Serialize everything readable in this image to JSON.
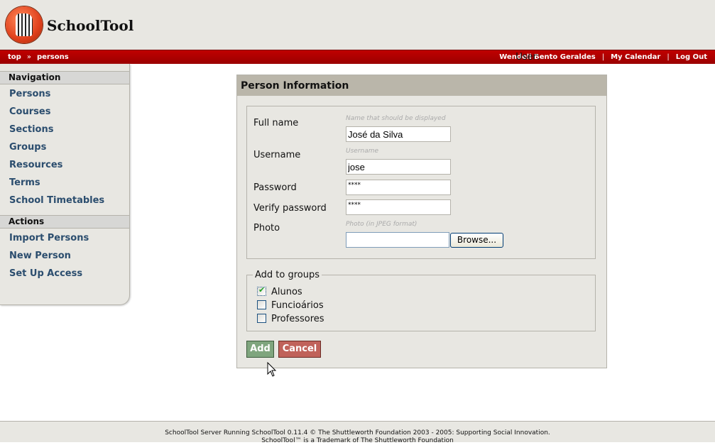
{
  "header": {
    "title": "SchoolTool"
  },
  "breadcrumb": [
    "top",
    "persons"
  ],
  "breadcrumb_sep": "»",
  "userbar": {
    "label": "User:",
    "user": "Wendell Bento Geraldes",
    "calendar": "My Calendar",
    "logout": "Log Out",
    "sep": "|"
  },
  "sidebar": {
    "navigation_title": "Navigation",
    "navigation": [
      "Persons",
      "Courses",
      "Sections",
      "Groups",
      "Resources",
      "Terms",
      "School Timetables"
    ],
    "actions_title": "Actions",
    "actions": [
      "Import Persons",
      "New Person",
      "Set Up Access"
    ]
  },
  "form": {
    "title": "Person Information",
    "full_name": {
      "label": "Full name",
      "hint": "Name that should be displayed",
      "value": "José da Silva"
    },
    "username": {
      "label": "Username",
      "hint": "Username",
      "value": "jose"
    },
    "password": {
      "label": "Password",
      "value": "****"
    },
    "verify": {
      "label": "Verify password",
      "value": "****"
    },
    "photo": {
      "label": "Photo",
      "hint": "Photo (in JPEG format)",
      "value": "",
      "browse": "Browse..."
    },
    "groups_legend": "Add to groups",
    "groups": [
      {
        "label": "Alunos",
        "checked": true
      },
      {
        "label": "Funcioários",
        "checked": false
      },
      {
        "label": "Professores",
        "checked": false
      }
    ],
    "add": "Add",
    "cancel": "Cancel"
  },
  "footer": {
    "line1": "SchoolTool Server Running SchoolTool 0.11.4 © The Shuttleworth Foundation 2003 - 2005: Supporting Social Innovation.",
    "line2": "SchoolTool™ is a Trademark of The Shuttleworth Foundation"
  },
  "colors": {
    "bar": "#b00000",
    "add": "#7fa57e",
    "cancel": "#c0625a",
    "link": "#2b4d6e"
  }
}
